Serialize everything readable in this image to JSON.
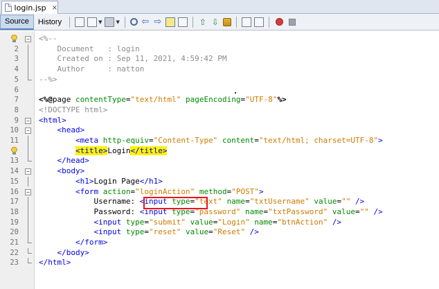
{
  "tab": {
    "filename": "login.jsp",
    "close": "×"
  },
  "toolbar": {
    "source_label": "Source",
    "history_label": "History"
  },
  "editor": {
    "lines": [
      {
        "num": "1",
        "segs": [
          {
            "c": "t-cmt",
            "t": "<%--"
          }
        ]
      },
      {
        "num": "2",
        "segs": [
          {
            "c": "t-cmt",
            "t": "    Document   : login"
          }
        ]
      },
      {
        "num": "3",
        "segs": [
          {
            "c": "t-cmt",
            "t": "    Created on : Sep 11, 2021, 4:59:42 PM"
          }
        ]
      },
      {
        "num": "4",
        "segs": [
          {
            "c": "t-cmt",
            "t": "    Author     : natton"
          }
        ]
      },
      {
        "num": "5",
        "segs": [
          {
            "c": "t-cmt",
            "t": "--%>"
          }
        ]
      },
      {
        "num": "6",
        "segs": []
      },
      {
        "num": "7",
        "segs": [
          {
            "c": "t-dir",
            "t": "<%@"
          },
          {
            "c": "t-dirk",
            "t": "page "
          },
          {
            "c": "t-attr",
            "t": "contentType"
          },
          {
            "c": "t-txt",
            "t": "="
          },
          {
            "c": "t-val",
            "t": "\"text/html\""
          },
          {
            "c": "t-txt",
            "t": " "
          },
          {
            "c": "t-attr",
            "t": "pageEncoding"
          },
          {
            "c": "t-txt",
            "t": "="
          },
          {
            "c": "t-val",
            "t": "\"UTF-8\""
          },
          {
            "c": "t-dir",
            "t": "%>"
          }
        ]
      },
      {
        "num": "8",
        "segs": [
          {
            "c": "t-cmt",
            "t": "<!DOCTYPE html>"
          }
        ]
      },
      {
        "num": "9",
        "segs": [
          {
            "c": "t-tag",
            "t": "<html>"
          }
        ]
      },
      {
        "num": "10",
        "segs": [
          {
            "c": "t-txt",
            "t": "    "
          },
          {
            "c": "t-tag",
            "t": "<head>"
          }
        ]
      },
      {
        "num": "11",
        "segs": [
          {
            "c": "t-txt",
            "t": "        "
          },
          {
            "c": "t-tag",
            "t": "<meta "
          },
          {
            "c": "t-attr",
            "t": "http-equiv"
          },
          {
            "c": "t-txt",
            "t": "="
          },
          {
            "c": "t-val",
            "t": "\"Content-Type\""
          },
          {
            "c": "t-txt",
            "t": " "
          },
          {
            "c": "t-attr",
            "t": "content"
          },
          {
            "c": "t-txt",
            "t": "="
          },
          {
            "c": "t-val",
            "t": "\"text/html; charset=UTF-8\""
          },
          {
            "c": "t-tag",
            "t": ">"
          }
        ]
      },
      {
        "num": "12",
        "segs": [
          {
            "c": "t-txt",
            "t": "        "
          },
          {
            "c": "t-tag t-hl",
            "t": "<title>"
          },
          {
            "c": "t-txt",
            "t": "Login"
          },
          {
            "c": "t-tag t-hl",
            "t": "</title>"
          }
        ]
      },
      {
        "num": "13",
        "segs": [
          {
            "c": "t-txt",
            "t": "    "
          },
          {
            "c": "t-tag",
            "t": "</head>"
          }
        ]
      },
      {
        "num": "14",
        "segs": [
          {
            "c": "t-txt",
            "t": "    "
          },
          {
            "c": "t-tag",
            "t": "<body>"
          }
        ]
      },
      {
        "num": "15",
        "segs": [
          {
            "c": "t-txt",
            "t": "        "
          },
          {
            "c": "t-tag",
            "t": "<h1>"
          },
          {
            "c": "t-txt",
            "t": "Login Page"
          },
          {
            "c": "t-tag",
            "t": "</h1>"
          }
        ]
      },
      {
        "num": "16",
        "segs": [
          {
            "c": "t-txt",
            "t": "        "
          },
          {
            "c": "t-tag",
            "t": "<form "
          },
          {
            "c": "t-attr",
            "t": "action"
          },
          {
            "c": "t-txt",
            "t": "="
          },
          {
            "c": "t-val",
            "t": "\"loginAction\""
          },
          {
            "c": "t-txt",
            "t": " "
          },
          {
            "c": "t-attr",
            "t": "method"
          },
          {
            "c": "t-txt",
            "t": "="
          },
          {
            "c": "t-val",
            "t": "\"POST\""
          },
          {
            "c": "t-tag",
            "t": ">"
          }
        ]
      },
      {
        "num": "17",
        "segs": [
          {
            "c": "t-txt",
            "t": "            Username: "
          },
          {
            "c": "t-tag",
            "t": "<input "
          },
          {
            "c": "t-attr",
            "t": "type"
          },
          {
            "c": "t-txt",
            "t": "="
          },
          {
            "c": "t-val",
            "t": "\"text\""
          },
          {
            "c": "t-txt",
            "t": " "
          },
          {
            "c": "t-attr",
            "t": "name"
          },
          {
            "c": "t-txt",
            "t": "="
          },
          {
            "c": "t-val",
            "t": "\"txtUsername\""
          },
          {
            "c": "t-txt",
            "t": " "
          },
          {
            "c": "t-attr",
            "t": "value"
          },
          {
            "c": "t-txt",
            "t": "="
          },
          {
            "c": "t-val",
            "t": "\"\""
          },
          {
            "c": "t-tag",
            "t": " />"
          }
        ]
      },
      {
        "num": "18",
        "segs": [
          {
            "c": "t-txt",
            "t": "            Password: "
          },
          {
            "c": "t-tag",
            "t": "<input "
          },
          {
            "c": "t-attr",
            "t": "type"
          },
          {
            "c": "t-txt",
            "t": "="
          },
          {
            "c": "t-val",
            "t": "\"password\""
          },
          {
            "c": "t-txt",
            "t": " "
          },
          {
            "c": "t-attr",
            "t": "name"
          },
          {
            "c": "t-txt",
            "t": "="
          },
          {
            "c": "t-val",
            "t": "\"txtPassword\""
          },
          {
            "c": "t-txt",
            "t": " "
          },
          {
            "c": "t-attr",
            "t": "value"
          },
          {
            "c": "t-txt",
            "t": "="
          },
          {
            "c": "t-val",
            "t": "\"\""
          },
          {
            "c": "t-tag",
            "t": " />"
          }
        ]
      },
      {
        "num": "19",
        "segs": [
          {
            "c": "t-txt",
            "t": "            "
          },
          {
            "c": "t-tag",
            "t": "<input "
          },
          {
            "c": "t-attr",
            "t": "type"
          },
          {
            "c": "t-txt",
            "t": "="
          },
          {
            "c": "t-val",
            "t": "\"submit\""
          },
          {
            "c": "t-txt",
            "t": " "
          },
          {
            "c": "t-attr",
            "t": "value"
          },
          {
            "c": "t-txt",
            "t": "="
          },
          {
            "c": "t-val",
            "t": "\"Login\""
          },
          {
            "c": "t-txt",
            "t": " "
          },
          {
            "c": "t-attr",
            "t": "name"
          },
          {
            "c": "t-txt",
            "t": "="
          },
          {
            "c": "t-val",
            "t": "\"btnAction\""
          },
          {
            "c": "t-tag",
            "t": " />"
          }
        ]
      },
      {
        "num": "20",
        "segs": [
          {
            "c": "t-txt",
            "t": "            "
          },
          {
            "c": "t-tag",
            "t": "<input "
          },
          {
            "c": "t-attr",
            "t": "type"
          },
          {
            "c": "t-txt",
            "t": "="
          },
          {
            "c": "t-val",
            "t": "\"reset\""
          },
          {
            "c": "t-txt",
            "t": " "
          },
          {
            "c": "t-attr",
            "t": "value"
          },
          {
            "c": "t-txt",
            "t": "="
          },
          {
            "c": "t-val",
            "t": "\"Reset\""
          },
          {
            "c": "t-tag",
            "t": " />"
          }
        ]
      },
      {
        "num": "21",
        "segs": [
          {
            "c": "t-txt",
            "t": "        "
          },
          {
            "c": "t-tag",
            "t": "</form>"
          }
        ]
      },
      {
        "num": "22",
        "segs": [
          {
            "c": "t-txt",
            "t": "    "
          },
          {
            "c": "t-tag",
            "t": "</body>"
          }
        ]
      },
      {
        "num": "23",
        "segs": [
          {
            "c": "t-tag",
            "t": "</html>"
          }
        ]
      }
    ]
  },
  "colors": {
    "highlight": "#fff200",
    "annotation_box": "#e8141e",
    "tag": "#0000e6",
    "attribute": "#008a00",
    "value": "#ce7b00",
    "comment": "#8c8c8c"
  },
  "icons": [
    "file-icon",
    "back-history-icon",
    "forward-history-icon",
    "find-icon",
    "find-prev-icon",
    "find-next-icon",
    "toggle-highlight-icon",
    "toggle-rect-select-icon",
    "prev-bookmark-icon",
    "next-bookmark-icon",
    "toggle-bookmark-icon",
    "shift-left-icon",
    "shift-right-icon",
    "record-macro-icon",
    "stop-macro-icon",
    "lightbulb-icon"
  ]
}
